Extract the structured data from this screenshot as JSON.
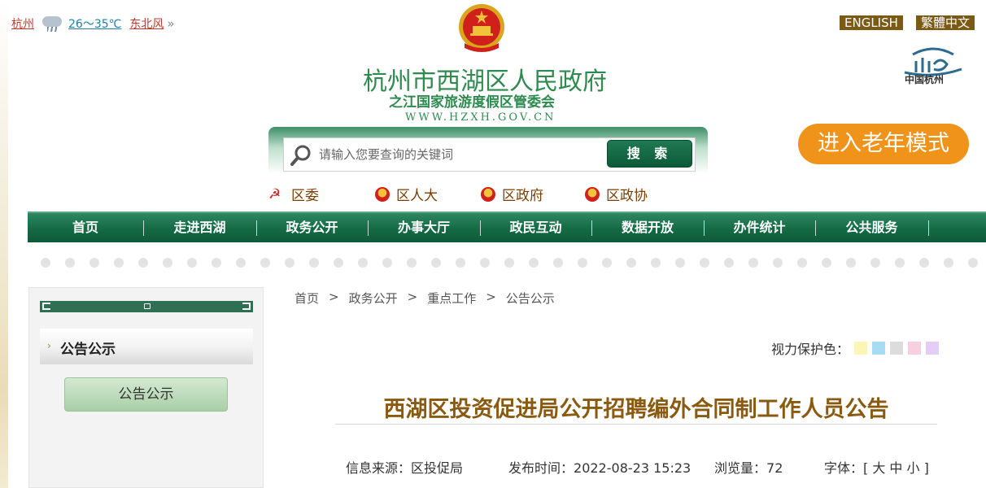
{
  "weather": {
    "city": "杭州",
    "temp": "26～35℃",
    "wind": "东北风",
    "more": "»"
  },
  "header": {
    "title": "杭州市西湖区人民政府",
    "subtitle": "之江国家旅游度假区管委会",
    "url": "WWW.HZXH.GOV.CN",
    "lang_en": "ENGLISH",
    "lang_tw": "繁體中文",
    "hz_logo_text": "中国杭州"
  },
  "search": {
    "placeholder": "请输入您要查询的关键词",
    "button": "搜 索"
  },
  "elder_mode": "进入老年模式",
  "quick_links": [
    {
      "label": "区委",
      "icon": "party-emblem-icon"
    },
    {
      "label": "区人大",
      "icon": "national-emblem-icon"
    },
    {
      "label": "区政府",
      "icon": "national-emblem-icon"
    },
    {
      "label": "区政协",
      "icon": "cppcc-emblem-icon"
    }
  ],
  "nav": [
    "首页",
    "走进西湖",
    "政务公开",
    "办事大厅",
    "政民互动",
    "数据开放",
    "办件统计",
    "公共服务"
  ],
  "sidebar": {
    "heading": "公告公示",
    "button": "公告公示"
  },
  "breadcrumb": [
    "首页",
    "政务公开",
    "重点工作",
    "公告公示"
  ],
  "breadcrumb_sep": ">",
  "eye_protect": {
    "label": "视力保护色：",
    "colors": [
      "#fbf6b3",
      "#a8dcf4",
      "#dcdcdc",
      "#f8cfe0",
      "#e6cdf5"
    ]
  },
  "article": {
    "title": "西湖区投资促进局公开招聘编外合同制工作人员公告",
    "source_label": "信息来源：",
    "source": "区投促局",
    "time_label": "发布时间：",
    "time": "2022-08-23 15:23",
    "views_label": "浏览量：",
    "views": "72",
    "font_label": "字体：",
    "font_options": "[ 大 中 小 ]"
  },
  "colors": {
    "brand_green": "#146a44",
    "title_brown": "#8a5a11",
    "elder_orange": "#f0931a"
  }
}
